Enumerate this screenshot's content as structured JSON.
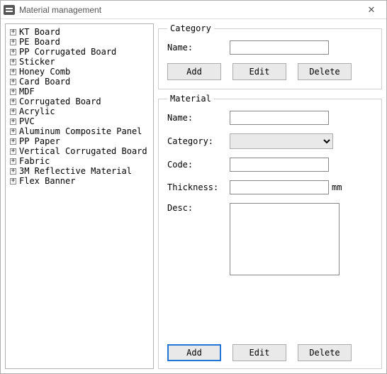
{
  "window": {
    "title": "Material management"
  },
  "tree": {
    "items": [
      "KT Board",
      "PE Board",
      "PP Corrugated Board",
      "Sticker",
      "Honey Comb",
      "Card Board",
      "MDF",
      "Corrugated Board",
      "Acrylic",
      "PVC",
      "Aluminum Composite Panel",
      "PP Paper",
      "Vertical Corrugated Board",
      "Fabric",
      "3M Reflective Material",
      "Flex Banner"
    ]
  },
  "category": {
    "legend": "Category",
    "name_label": "Name:",
    "name_value": "",
    "add_label": "Add",
    "edit_label": "Edit",
    "delete_label": "Delete"
  },
  "material": {
    "legend": "Material",
    "name_label": "Name:",
    "name_value": "",
    "category_label": "Category:",
    "category_value": "",
    "code_label": "Code:",
    "code_value": "",
    "thickness_label": "Thickness:",
    "thickness_value": "",
    "thickness_unit": "mm",
    "desc_label": "Desc:",
    "desc_value": "",
    "add_label": "Add",
    "edit_label": "Edit",
    "delete_label": "Delete"
  }
}
